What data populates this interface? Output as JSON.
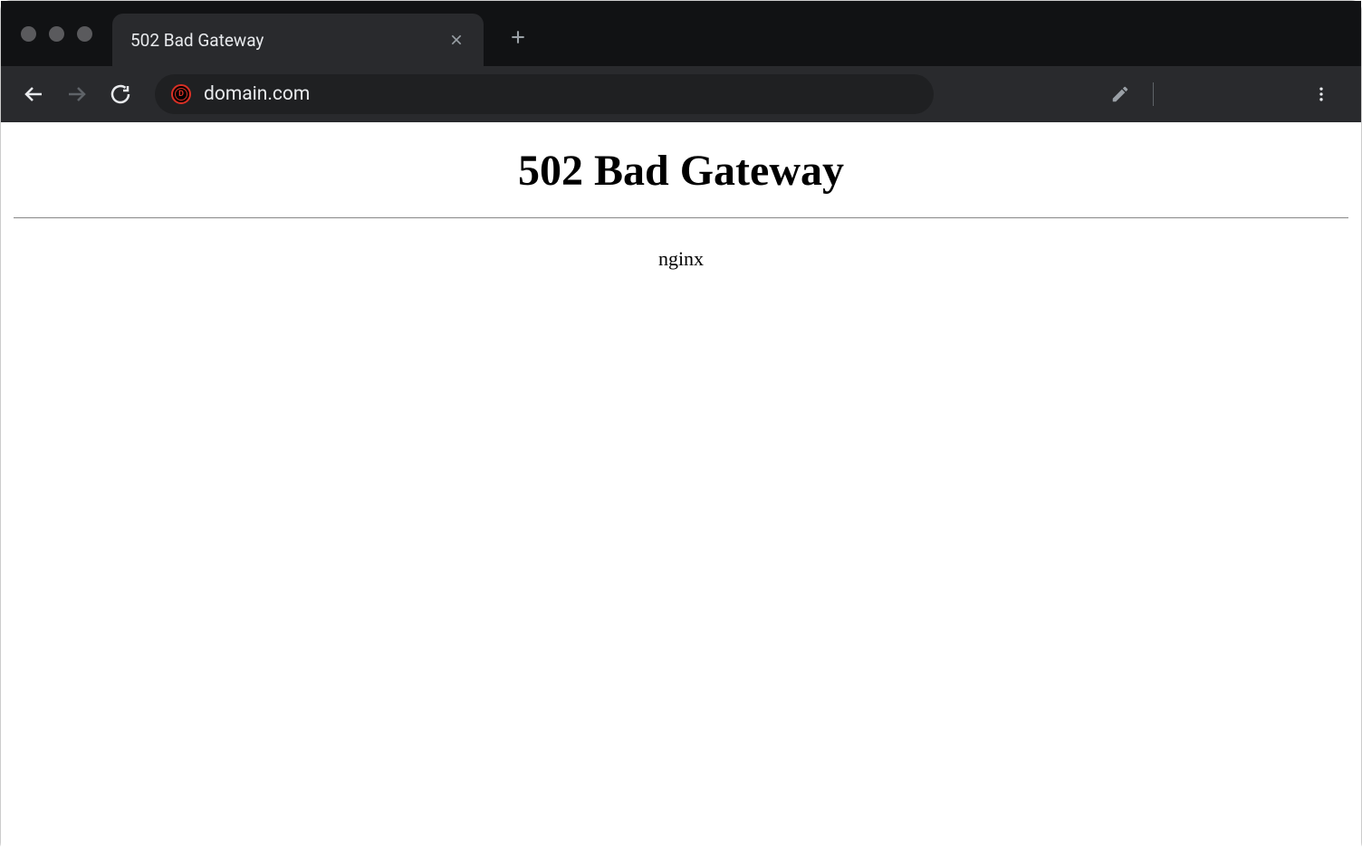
{
  "tab": {
    "title": "502 Bad Gateway"
  },
  "addressBar": {
    "url": "domain.com"
  },
  "page": {
    "heading": "502 Bad Gateway",
    "server": "nginx"
  }
}
